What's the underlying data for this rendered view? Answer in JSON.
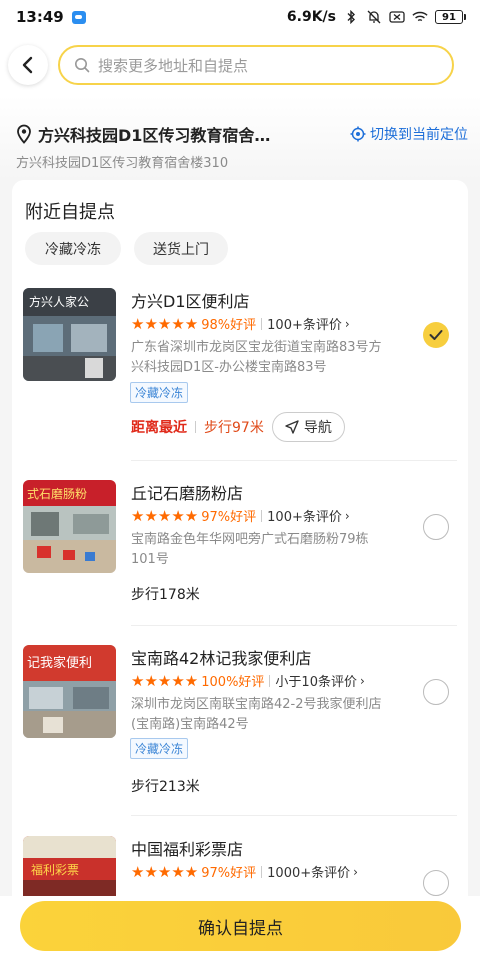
{
  "status_bar": {
    "time": "13:49",
    "net_speed": "6.9K/s",
    "battery": "91"
  },
  "header": {
    "search_placeholder": "搜索更多地址和自提点"
  },
  "address": {
    "title": "方兴科技园D1区传习教育宿舍…",
    "subtitle": "方兴科技园D1区传习教育宿舍楼310",
    "switch_label": "切换到当前定位",
    "accent": "#1e6fd9"
  },
  "card": {
    "title": "附近自提点",
    "filters": [
      "冷藏冷冻",
      "送货上门"
    ]
  },
  "stores": [
    {
      "name": "方兴D1区便利店",
      "stars": "★★★★★",
      "good_rate": "98%好评",
      "reviews": "100+条评价",
      "address": "广东省深圳市龙岗区宝龙街道宝南路83号方兴科技园D1区-办公楼宝南路83号",
      "tag": "冷藏冷冻",
      "nearest_label": "距离最近",
      "walk": "步行97米",
      "nav_label": "导航",
      "selected": true,
      "sign_text": "方兴人家公"
    },
    {
      "name": "丘记石磨肠粉店",
      "stars": "★★★★★",
      "good_rate": "97%好评",
      "reviews": "100+条评价",
      "address": "宝南路金色年华网吧旁广式石磨肠粉79栋101号",
      "walk": "步行178米",
      "selected": false,
      "sign_text": "式石磨肠粉"
    },
    {
      "name": "宝南路42林记我家便利店",
      "stars": "★★★★★",
      "good_rate": "100%好评",
      "reviews": "小于10条评价",
      "address": "深圳市龙岗区南联宝南路42-2号我家便利店(宝南路)宝南路42号",
      "tag": "冷藏冷冻",
      "walk": "步行213米",
      "selected": false,
      "sign_text": "记我家便利"
    },
    {
      "name": "中国福利彩票店",
      "stars": "★★★★★",
      "good_rate": "97%好评",
      "reviews": "1000+条评价",
      "selected": false,
      "sign_text": "福利彩票"
    }
  ],
  "bottom": {
    "confirm_label": "确认自提点",
    "brand_color": "#f7ce3e"
  }
}
